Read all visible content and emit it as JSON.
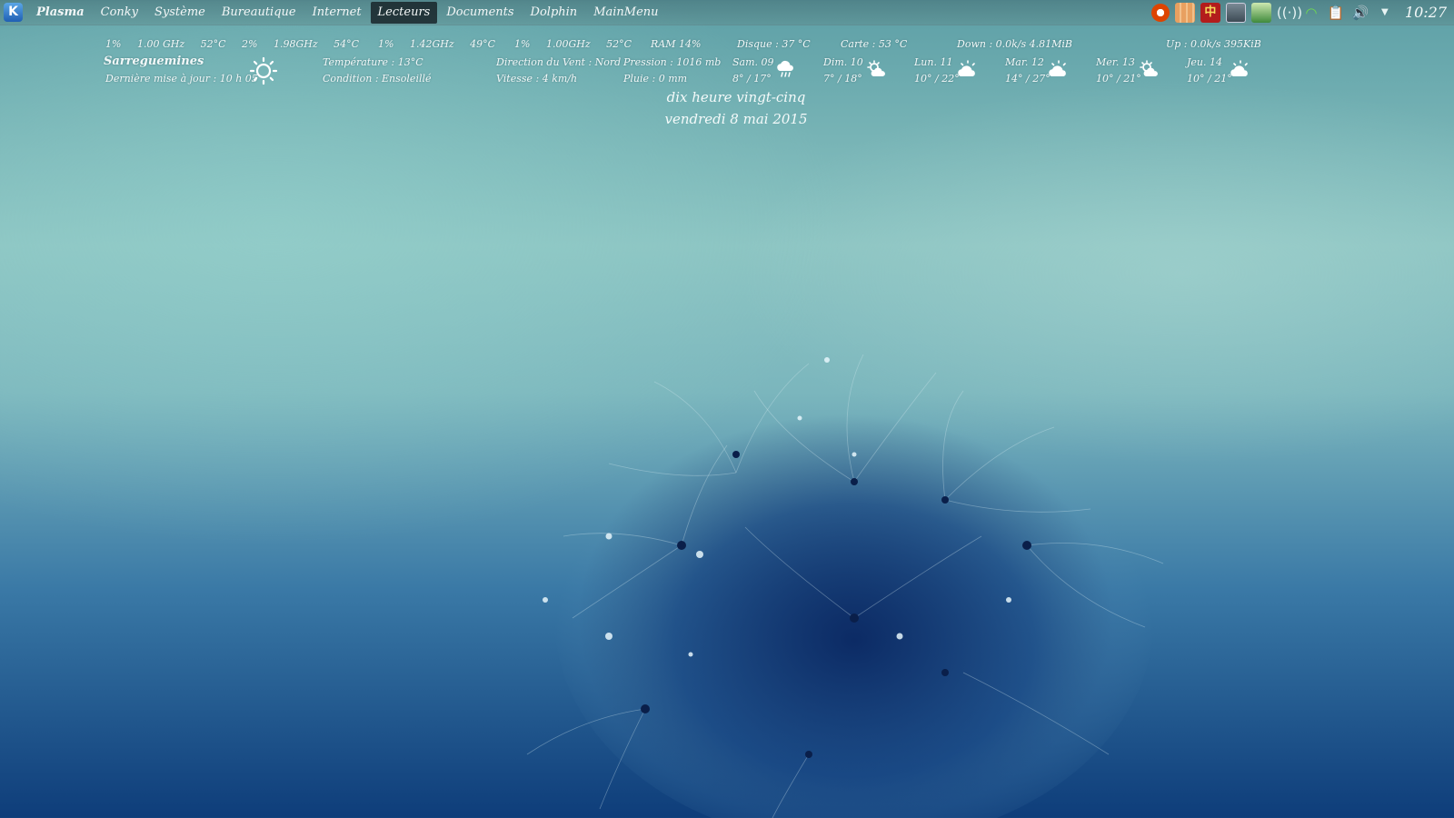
{
  "panel": {
    "launcher_glyph": "K",
    "menu": [
      {
        "label": "Plasma"
      },
      {
        "label": "Conky"
      },
      {
        "label": "Système"
      },
      {
        "label": "Bureautique"
      },
      {
        "label": "Internet"
      },
      {
        "label": "Lecteurs"
      },
      {
        "label": "Documents"
      },
      {
        "label": "Dolphin"
      },
      {
        "label": "MainMenu"
      }
    ],
    "active_menu": "Lecteurs",
    "tray_icons": [
      "opera-icon",
      "grid-app-icon",
      "red-app-icon",
      "panel-app-icon",
      "green-app-icon",
      "signal-icon",
      "wifi-icon",
      "clipboard-icon",
      "volume-icon",
      "tray-expand-icon"
    ],
    "clock": "10:27"
  },
  "conky": {
    "cpu": [
      {
        "load": "1%",
        "freq": "1.00 GHz",
        "temp": "52°C"
      },
      {
        "load": "2%",
        "freq": "1.98GHz",
        "temp": "54°C"
      },
      {
        "load": "1%",
        "freq": "1.42GHz",
        "temp": "49°C"
      },
      {
        "load": "1%",
        "freq": "1.00GHz",
        "temp": "52°C"
      }
    ],
    "ram": "RAM  14%",
    "disk": "Disque : 37 °C",
    "card": "Carte : 53 °C",
    "down": "Down : 0.0k/s    4.81MiB",
    "up": "Up : 0.0k/s    395KiB",
    "weather": {
      "city": "Sarreguemines",
      "last_update": "Dernière mise à jour : 10 h 05",
      "temperature": "Température : 13°C",
      "condition": "Condition :      Ensoleillé",
      "wind_dir": "Direction du Vent : Nord",
      "wind_speed": "Vitesse : 4 km/h",
      "pressure": "Pression : 1016 mb",
      "rain": "Pluie : 0 mm",
      "current_icon": "sun-icon",
      "forecast": [
        {
          "day": "Sam. 09",
          "range": "8° / 17°",
          "icon": "rain-cloud-icon"
        },
        {
          "day": "Dim. 10",
          "range": "7° / 18°",
          "icon": "sun-cloud-icon"
        },
        {
          "day": "Lun. 11",
          "range": "10° / 22°",
          "icon": "sun-cloud-icon"
        },
        {
          "day": "Mar. 12",
          "range": "14° / 27°",
          "icon": "sun-cloud-icon"
        },
        {
          "day": "Mer. 13",
          "range": "10° / 21°",
          "icon": "sun-cloud-icon"
        },
        {
          "day": "Jeu. 14",
          "range": "10° / 21°",
          "icon": "sun-cloud-icon"
        }
      ]
    },
    "time_words": "dix heure vingt-cinq",
    "date": "vendredi  8 mai 2015"
  }
}
